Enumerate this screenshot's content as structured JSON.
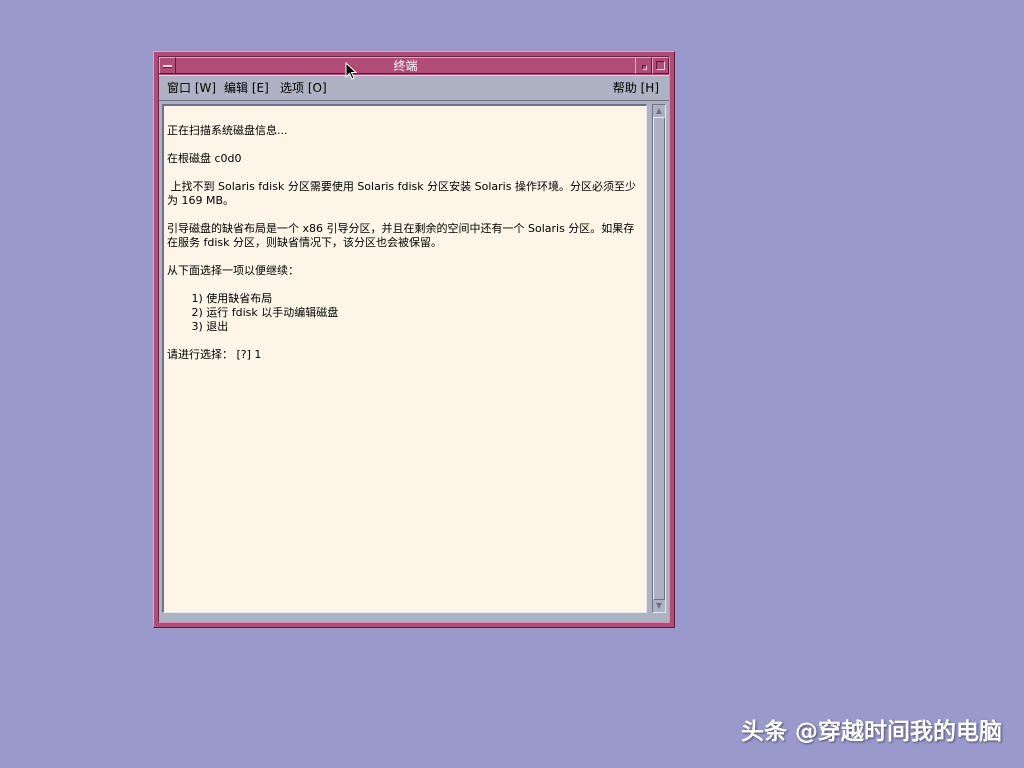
{
  "window": {
    "title": "终端"
  },
  "menubar": {
    "items": [
      {
        "label": "窗口 [W]"
      },
      {
        "label": "编辑 [E]"
      },
      {
        "label": "选项 [O]"
      }
    ],
    "help_label": "帮助 [H]"
  },
  "terminal": {
    "lines": [
      "正在扫描系统磁盘信息...",
      "",
      "在根磁盘 c0d0",
      "",
      " 上找不到 Solaris fdisk 分区需要使用 Solaris fdisk 分区安装 Solaris 操作环境。分区必须至少为 169 MB。",
      "",
      "引导磁盘的缺省布局是一个 x86 引导分区，并且在剩余的空间中还有一个 Solaris 分区。如果存在服务 fdisk 分区，则缺省情况下，该分区也会被保留。",
      "",
      "从下面选择一项以便继续：",
      "",
      "       1) 使用缺省布局",
      "       2) 运行 fdisk 以手动编辑磁盘",
      "       3) 退出",
      "",
      "请进行选择： [?] 1"
    ]
  },
  "scrollbar": {
    "up_arrow": "▲",
    "down_arrow": "▼"
  },
  "watermark": {
    "text": "头条 @穿越时间我的电脑"
  },
  "colors": {
    "desktop": "#9999cc",
    "frame": "#b14c78",
    "menubar": "#aeb2c3",
    "terminal_bg": "#fdf6e8"
  }
}
